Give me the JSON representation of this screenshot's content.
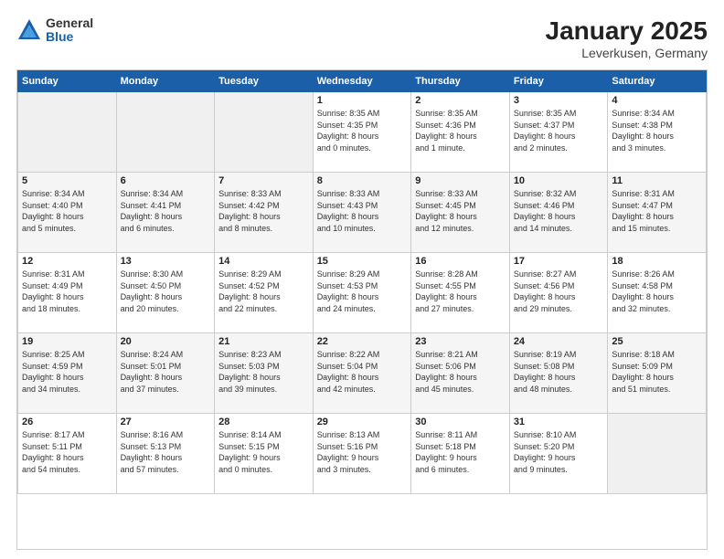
{
  "header": {
    "logo_general": "General",
    "logo_blue": "Blue",
    "title": "January 2025",
    "subtitle": "Leverkusen, Germany"
  },
  "weekdays": [
    "Sunday",
    "Monday",
    "Tuesday",
    "Wednesday",
    "Thursday",
    "Friday",
    "Saturday"
  ],
  "weeks": [
    [
      {
        "day": "",
        "info": ""
      },
      {
        "day": "",
        "info": ""
      },
      {
        "day": "",
        "info": ""
      },
      {
        "day": "1",
        "info": "Sunrise: 8:35 AM\nSunset: 4:35 PM\nDaylight: 8 hours\nand 0 minutes."
      },
      {
        "day": "2",
        "info": "Sunrise: 8:35 AM\nSunset: 4:36 PM\nDaylight: 8 hours\nand 1 minute."
      },
      {
        "day": "3",
        "info": "Sunrise: 8:35 AM\nSunset: 4:37 PM\nDaylight: 8 hours\nand 2 minutes."
      },
      {
        "day": "4",
        "info": "Sunrise: 8:34 AM\nSunset: 4:38 PM\nDaylight: 8 hours\nand 3 minutes."
      }
    ],
    [
      {
        "day": "5",
        "info": "Sunrise: 8:34 AM\nSunset: 4:40 PM\nDaylight: 8 hours\nand 5 minutes."
      },
      {
        "day": "6",
        "info": "Sunrise: 8:34 AM\nSunset: 4:41 PM\nDaylight: 8 hours\nand 6 minutes."
      },
      {
        "day": "7",
        "info": "Sunrise: 8:33 AM\nSunset: 4:42 PM\nDaylight: 8 hours\nand 8 minutes."
      },
      {
        "day": "8",
        "info": "Sunrise: 8:33 AM\nSunset: 4:43 PM\nDaylight: 8 hours\nand 10 minutes."
      },
      {
        "day": "9",
        "info": "Sunrise: 8:33 AM\nSunset: 4:45 PM\nDaylight: 8 hours\nand 12 minutes."
      },
      {
        "day": "10",
        "info": "Sunrise: 8:32 AM\nSunset: 4:46 PM\nDaylight: 8 hours\nand 14 minutes."
      },
      {
        "day": "11",
        "info": "Sunrise: 8:31 AM\nSunset: 4:47 PM\nDaylight: 8 hours\nand 15 minutes."
      }
    ],
    [
      {
        "day": "12",
        "info": "Sunrise: 8:31 AM\nSunset: 4:49 PM\nDaylight: 8 hours\nand 18 minutes."
      },
      {
        "day": "13",
        "info": "Sunrise: 8:30 AM\nSunset: 4:50 PM\nDaylight: 8 hours\nand 20 minutes."
      },
      {
        "day": "14",
        "info": "Sunrise: 8:29 AM\nSunset: 4:52 PM\nDaylight: 8 hours\nand 22 minutes."
      },
      {
        "day": "15",
        "info": "Sunrise: 8:29 AM\nSunset: 4:53 PM\nDaylight: 8 hours\nand 24 minutes."
      },
      {
        "day": "16",
        "info": "Sunrise: 8:28 AM\nSunset: 4:55 PM\nDaylight: 8 hours\nand 27 minutes."
      },
      {
        "day": "17",
        "info": "Sunrise: 8:27 AM\nSunset: 4:56 PM\nDaylight: 8 hours\nand 29 minutes."
      },
      {
        "day": "18",
        "info": "Sunrise: 8:26 AM\nSunset: 4:58 PM\nDaylight: 8 hours\nand 32 minutes."
      }
    ],
    [
      {
        "day": "19",
        "info": "Sunrise: 8:25 AM\nSunset: 4:59 PM\nDaylight: 8 hours\nand 34 minutes."
      },
      {
        "day": "20",
        "info": "Sunrise: 8:24 AM\nSunset: 5:01 PM\nDaylight: 8 hours\nand 37 minutes."
      },
      {
        "day": "21",
        "info": "Sunrise: 8:23 AM\nSunset: 5:03 PM\nDaylight: 8 hours\nand 39 minutes."
      },
      {
        "day": "22",
        "info": "Sunrise: 8:22 AM\nSunset: 5:04 PM\nDaylight: 8 hours\nand 42 minutes."
      },
      {
        "day": "23",
        "info": "Sunrise: 8:21 AM\nSunset: 5:06 PM\nDaylight: 8 hours\nand 45 minutes."
      },
      {
        "day": "24",
        "info": "Sunrise: 8:19 AM\nSunset: 5:08 PM\nDaylight: 8 hours\nand 48 minutes."
      },
      {
        "day": "25",
        "info": "Sunrise: 8:18 AM\nSunset: 5:09 PM\nDaylight: 8 hours\nand 51 minutes."
      }
    ],
    [
      {
        "day": "26",
        "info": "Sunrise: 8:17 AM\nSunset: 5:11 PM\nDaylight: 8 hours\nand 54 minutes."
      },
      {
        "day": "27",
        "info": "Sunrise: 8:16 AM\nSunset: 5:13 PM\nDaylight: 8 hours\nand 57 minutes."
      },
      {
        "day": "28",
        "info": "Sunrise: 8:14 AM\nSunset: 5:15 PM\nDaylight: 9 hours\nand 0 minutes."
      },
      {
        "day": "29",
        "info": "Sunrise: 8:13 AM\nSunset: 5:16 PM\nDaylight: 9 hours\nand 3 minutes."
      },
      {
        "day": "30",
        "info": "Sunrise: 8:11 AM\nSunset: 5:18 PM\nDaylight: 9 hours\nand 6 minutes."
      },
      {
        "day": "31",
        "info": "Sunrise: 8:10 AM\nSunset: 5:20 PM\nDaylight: 9 hours\nand 9 minutes."
      },
      {
        "day": "",
        "info": ""
      }
    ]
  ]
}
